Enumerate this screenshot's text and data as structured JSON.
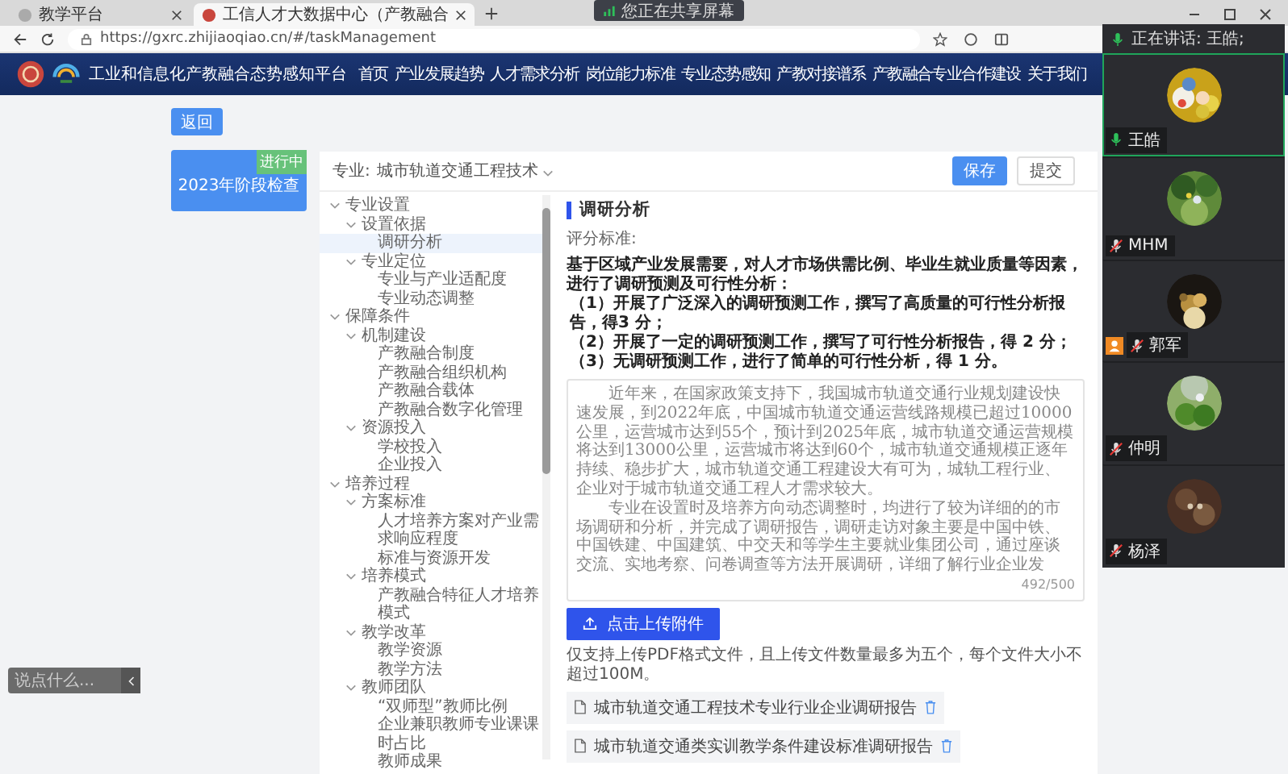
{
  "browser": {
    "tabs": [
      {
        "title": "教学平台",
        "selected": false
      },
      {
        "title": "工信人才大数据中心（产教融合",
        "selected": true
      }
    ],
    "url": "https://gxrc.zhijiaoqiao.cn/#/taskManagement",
    "share_banner": "您正在共享屏幕"
  },
  "header": {
    "title": "工业和信息化产教融合态势感知平台",
    "nav": [
      "首页",
      "产业发展趋势",
      "人才需求分析",
      "岗位能力标准",
      "专业态势感知",
      "产教对接谱系",
      "产教融合专业合作建设",
      "关于我们"
    ]
  },
  "back_button": "返回",
  "task_card": {
    "title": "2023年阶段检查",
    "status": "进行中"
  },
  "panel": {
    "major_label": "专业:",
    "major": "城市轨道交通工程技术",
    "buttons": [
      {
        "label": "保存",
        "kind": "primary"
      },
      {
        "label": "提交",
        "kind": "default"
      }
    ]
  },
  "tree": [
    {
      "label": "专业设置",
      "selected": false,
      "expanded": true,
      "children": [
        {
          "label": "设置依据",
          "selected": false,
          "expanded": true,
          "children": [
            {
              "label": "调研分析",
              "selected": true
            }
          ]
        },
        {
          "label": "专业定位",
          "selected": false,
          "expanded": true,
          "children": [
            {
              "label": "专业与产业适配度",
              "selected": false
            },
            {
              "label": "专业动态调整",
              "selected": false
            }
          ]
        }
      ]
    },
    {
      "label": "保障条件",
      "selected": false,
      "expanded": true,
      "children": [
        {
          "label": "机制建设",
          "selected": false,
          "expanded": true,
          "children": [
            {
              "label": "产教融合制度",
              "selected": false
            },
            {
              "label": "产教融合组织机构",
              "selected": false
            },
            {
              "label": "产教融合载体",
              "selected": false
            },
            {
              "label": "产教融合数字化管理",
              "selected": false
            }
          ]
        },
        {
          "label": "资源投入",
          "selected": false,
          "expanded": true,
          "children": [
            {
              "label": "学校投入",
              "selected": false
            },
            {
              "label": "企业投入",
              "selected": false
            }
          ]
        }
      ]
    },
    {
      "label": "培养过程",
      "selected": false,
      "expanded": true,
      "children": [
        {
          "label": "方案标准",
          "selected": false,
          "expanded": true,
          "children": [
            {
              "label": "人才培养方案对产业需求响应程度",
              "selected": false
            },
            {
              "label": "标准与资源开发",
              "selected": false
            }
          ]
        },
        {
          "label": "培养模式",
          "selected": false,
          "expanded": true,
          "children": [
            {
              "label": "产教融合特征人才培养模式",
              "selected": false
            }
          ]
        },
        {
          "label": "教学改革",
          "selected": false,
          "expanded": true,
          "children": [
            {
              "label": "教学资源",
              "selected": false
            },
            {
              "label": "教学方法",
              "selected": false
            }
          ]
        },
        {
          "label": "教师团队",
          "selected": false,
          "expanded": true,
          "children": [
            {
              "label": "“双师型”教师比例",
              "selected": false
            },
            {
              "label": "企业兼职教师专业课课时占比",
              "selected": false
            },
            {
              "label": "教师成果",
              "selected": false
            }
          ]
        }
      ]
    }
  ],
  "content": {
    "title": "调研分析",
    "criteria_label": "评分标准:",
    "criteria": [
      "基于区域产业发展需要，对人才市场供需比例、毕业生就业质量等因素，进行了调研预测及可行性分析：",
      "（1）开展了广泛深入的调研预测工作，撰写了高质量的可行性分析报告，得3 分；",
      "（2）开展了一定的调研预测工作，撰写了可行性分析报告，得 2 分；",
      "（3）无调研预测工作，进行了简单的可行性分析，得 1 分。"
    ],
    "answer": {
      "paragraphs": [
        "近年来，在国家政策支持下，我国城市轨道交通行业规划建设快速发展，到2022年底，中国城市轨道交通运营线路规模已超过10000公里，运营城市达到55个，预计到2025年底，城市轨道交通运营规模将达到13000公里，运营城市将达到60个，城市轨道交通规模正逐年持续、稳步扩大，城市轨道交通工程建设大有可为，城轨工程行业、企业对于城市轨道交通工程人才需求较大。",
        "专业在设置时及培养方向动态调整时，均进行了较为详细的的市场调研和分析，并完成了调研报告，调研走访对象主要是中国中铁、中国铁建、中国建筑、中交天和等学生主要就业集团公司，通过座谈交流、实地考察、问卷调查等方法开展调研，详细了解行业企业发"
      ],
      "counter": "492/500"
    },
    "upload_button": "点击上传附件",
    "upload_note": "仅支持上传PDF格式文件，且上传文件数量最多为五个，每个文件大小不超过100M。",
    "files": [
      "城市轨道交通工程技术专业行业企业调研报告",
      "城市轨道交通类实训教学条件建设标准调研报告"
    ]
  },
  "meeting": {
    "speaking": "正在讲话: 王皓;",
    "participants": [
      {
        "name": "王皓",
        "muted": false,
        "speaking": true,
        "host": false
      },
      {
        "name": "MHM",
        "muted": true,
        "speaking": false,
        "host": false
      },
      {
        "name": "郭军",
        "muted": true,
        "speaking": false,
        "host": true
      },
      {
        "name": "仲明",
        "muted": true,
        "speaking": false,
        "host": false
      },
      {
        "name": "杨泽",
        "muted": true,
        "speaking": false,
        "host": false
      }
    ]
  },
  "chat": {
    "placeholder": "说点什么..."
  }
}
